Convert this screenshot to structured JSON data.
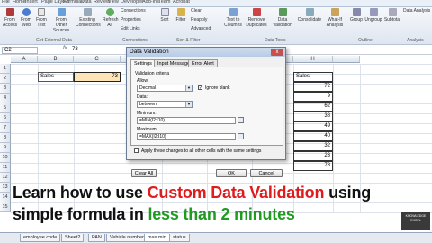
{
  "ribbon": {
    "tabs": [
      "File",
      "Home",
      "Insert",
      "Page Layout",
      "Formulas",
      "Data",
      "Review",
      "View",
      "Developer",
      "Add-Ins",
      "Team",
      "Acrobat"
    ],
    "buttons": [
      {
        "label": "From\nAccess"
      },
      {
        "label": "From\nWeb"
      },
      {
        "label": "From\nText"
      },
      {
        "label": "From Other\nSources"
      },
      {
        "label": "Existing\nConnections"
      },
      {
        "label": "Refresh\nAll"
      }
    ],
    "connections": [
      "Connections",
      "Properties",
      "Edit Links"
    ],
    "sort_filter": [
      "Sort",
      "Filter"
    ],
    "filter_opts": [
      "Clear",
      "Reapply",
      "Advanced"
    ],
    "data_tools": [
      "Text to\nColumns",
      "Remove\nDuplicates",
      "Data\nValidation",
      "Consolidate",
      "What-If\nAnalysis"
    ],
    "outline": [
      "Group",
      "Ungroup",
      "Subtotal"
    ],
    "analysis": "Data Analysis",
    "groups": [
      "Get External Data",
      "Connections",
      "Sort & Filter",
      "Data Tools",
      "Outline",
      "Analysis"
    ]
  },
  "formula_bar": {
    "name_box": "C2",
    "fx": "fx",
    "value": "73"
  },
  "columns": [
    "A",
    "B",
    "C",
    "D",
    "E",
    "F",
    "G",
    "H",
    "I"
  ],
  "rows": [
    "1",
    "2",
    "3",
    "4",
    "5",
    "6",
    "7",
    "8",
    "9",
    "10",
    "11",
    "12",
    "13",
    "14",
    "15"
  ],
  "cells": {
    "b2_label": "Sales",
    "c2_value": "73",
    "i_header": "Sales",
    "i_values": [
      "72",
      "9",
      "62",
      "38",
      "49",
      "40",
      "32",
      "23",
      "78"
    ]
  },
  "dialog": {
    "title": "Data Validation",
    "close": "x",
    "tabs": [
      "Settings",
      "Input Message",
      "Error Alert"
    ],
    "criteria_label": "Validation criteria",
    "allow_label": "Allow:",
    "allow_value": "Decimal",
    "ignore_blank": "Ignore blank",
    "data_label": "Data:",
    "data_value": "between",
    "min_label": "Minimum:",
    "min_value": "=MIN(I2:I10)",
    "max_label": "Maximum:",
    "max_value": "=MAX(I2:I10)",
    "apply_all": "Apply these changes to all other cells with the same settings",
    "clear_all": "Clear All",
    "ok": "OK",
    "cancel": "Cancel"
  },
  "caption": {
    "line1_a": "Learn how to use ",
    "line1_b": "Custom Data Validation",
    "line1_c": " using",
    "line2_a": "simple formula in ",
    "line2_b": "less than 2 minutes"
  },
  "sheets": [
    "employee code",
    "Sheet2",
    "PAN",
    "Vehicle number",
    "max min",
    "status"
  ],
  "logo": "KNOWLEDGE EXCEL"
}
